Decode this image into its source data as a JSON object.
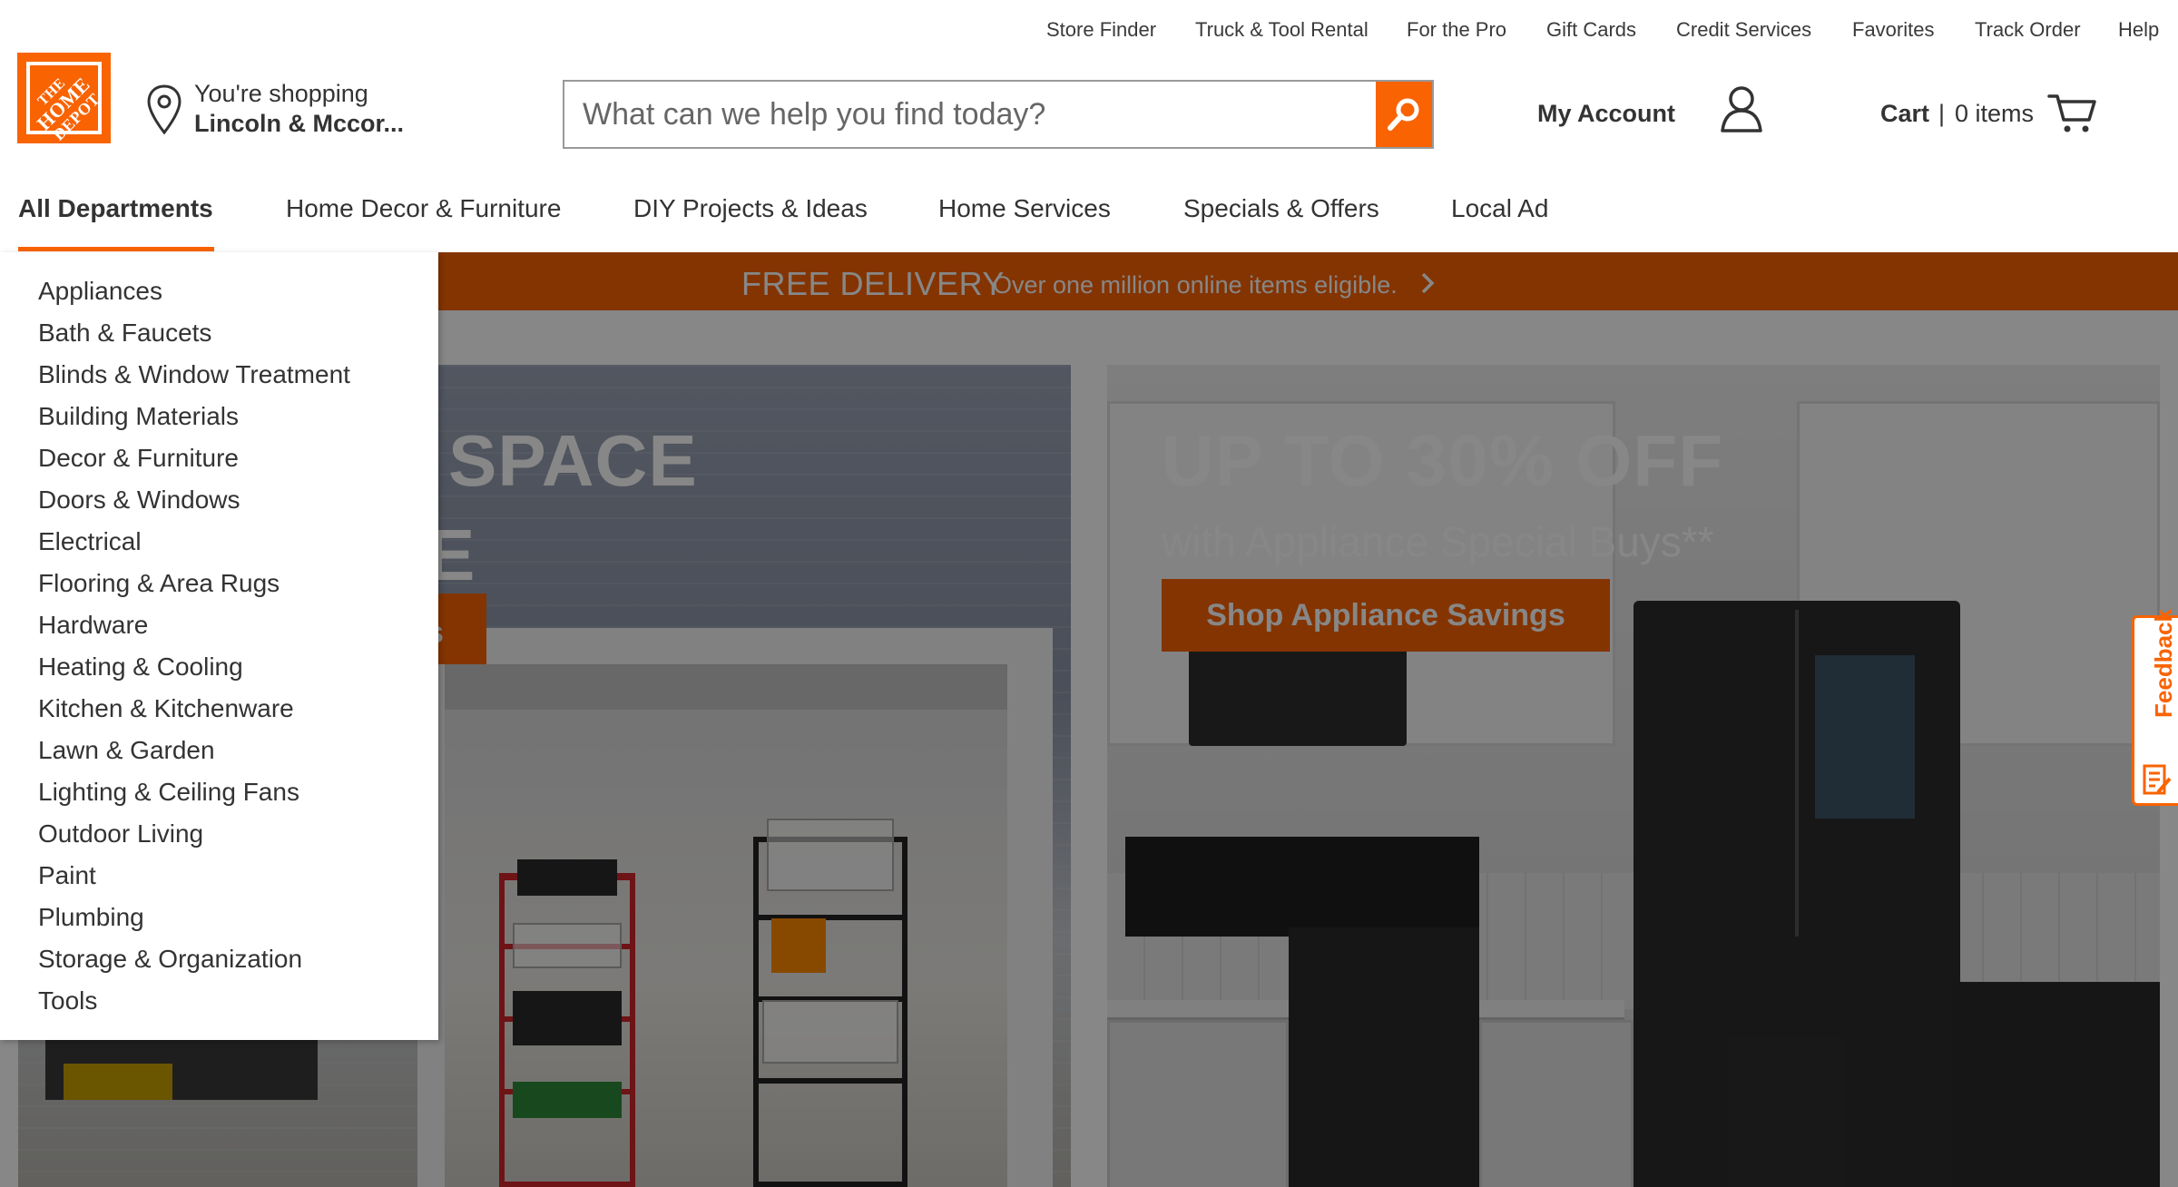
{
  "utility_nav": [
    "Store Finder",
    "Truck & Tool Rental",
    "For the Pro",
    "Gift Cards",
    "Credit Services",
    "Favorites",
    "Track Order",
    "Help"
  ],
  "logo": {
    "line1": "THE",
    "line2": "HOME",
    "line3": "DEPOT"
  },
  "store": {
    "line1": "You're shopping",
    "line2": "Lincoln & Mccor..."
  },
  "search": {
    "placeholder": "What can we help you find today?",
    "value": ""
  },
  "account": {
    "label": "My Account"
  },
  "cart": {
    "label": "Cart",
    "separator": "|",
    "count_text": "0 items"
  },
  "main_nav": [
    "All Departments",
    "Home Decor & Furniture",
    "DIY Projects & Ideas",
    "Home Services",
    "Specials & Offers",
    "Local Ad"
  ],
  "delivery_bar": {
    "strong": "FREE DELIVERY",
    "sub": "Over one million online items eligible."
  },
  "hero_left": {
    "headline": "SPACE",
    "line2": "E",
    "cta": "s"
  },
  "hero_right": {
    "headline": "UP TO 30% OFF",
    "subheadline": "with Appliance Special Buys**",
    "cta": "Shop Appliance Savings"
  },
  "feedback": {
    "label": "Feedback"
  },
  "departments": [
    "Appliances",
    "Bath & Faucets",
    "Blinds & Window Treatment",
    "Building Materials",
    "Decor & Furniture",
    "Doors & Windows",
    "Electrical",
    "Flooring & Area Rugs",
    "Hardware",
    "Heating & Cooling",
    "Kitchen & Kitchenware",
    "Lawn & Garden",
    "Lighting & Ceiling Fans",
    "Outdoor Living",
    "Paint",
    "Plumbing",
    "Storage & Organization",
    "Tools"
  ],
  "colors": {
    "brand_orange": "#f96302",
    "text": "#333333",
    "overlay": "rgba(0,0,0,0.47)"
  }
}
